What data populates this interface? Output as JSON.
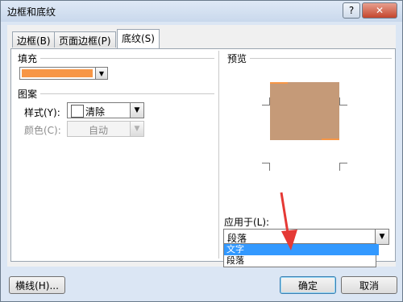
{
  "window": {
    "title": "边框和底纹"
  },
  "titlebar": {
    "help_label": "?",
    "close_label": "✕"
  },
  "tabs": [
    {
      "label": "边框(B)"
    },
    {
      "label": "页面边框(P)"
    },
    {
      "label": "底纹(S)"
    }
  ],
  "fill": {
    "section_label": "填充",
    "color": "#f79646"
  },
  "pattern": {
    "section_label": "图案",
    "style_label": "样式(Y):",
    "style_value": "清除",
    "color_label": "颜色(C):",
    "color_value": "自动"
  },
  "preview": {
    "section_label": "预览",
    "shading_color": "#c59a78"
  },
  "apply": {
    "label": "应用于(L):",
    "value": "段落",
    "options": [
      "文字",
      "段落"
    ],
    "selected_option": "文字"
  },
  "buttons": {
    "horizontal_line": "横线(H)...",
    "ok": "确定",
    "cancel": "取消"
  },
  "annotation": {
    "arrow_color": "#e53935"
  }
}
